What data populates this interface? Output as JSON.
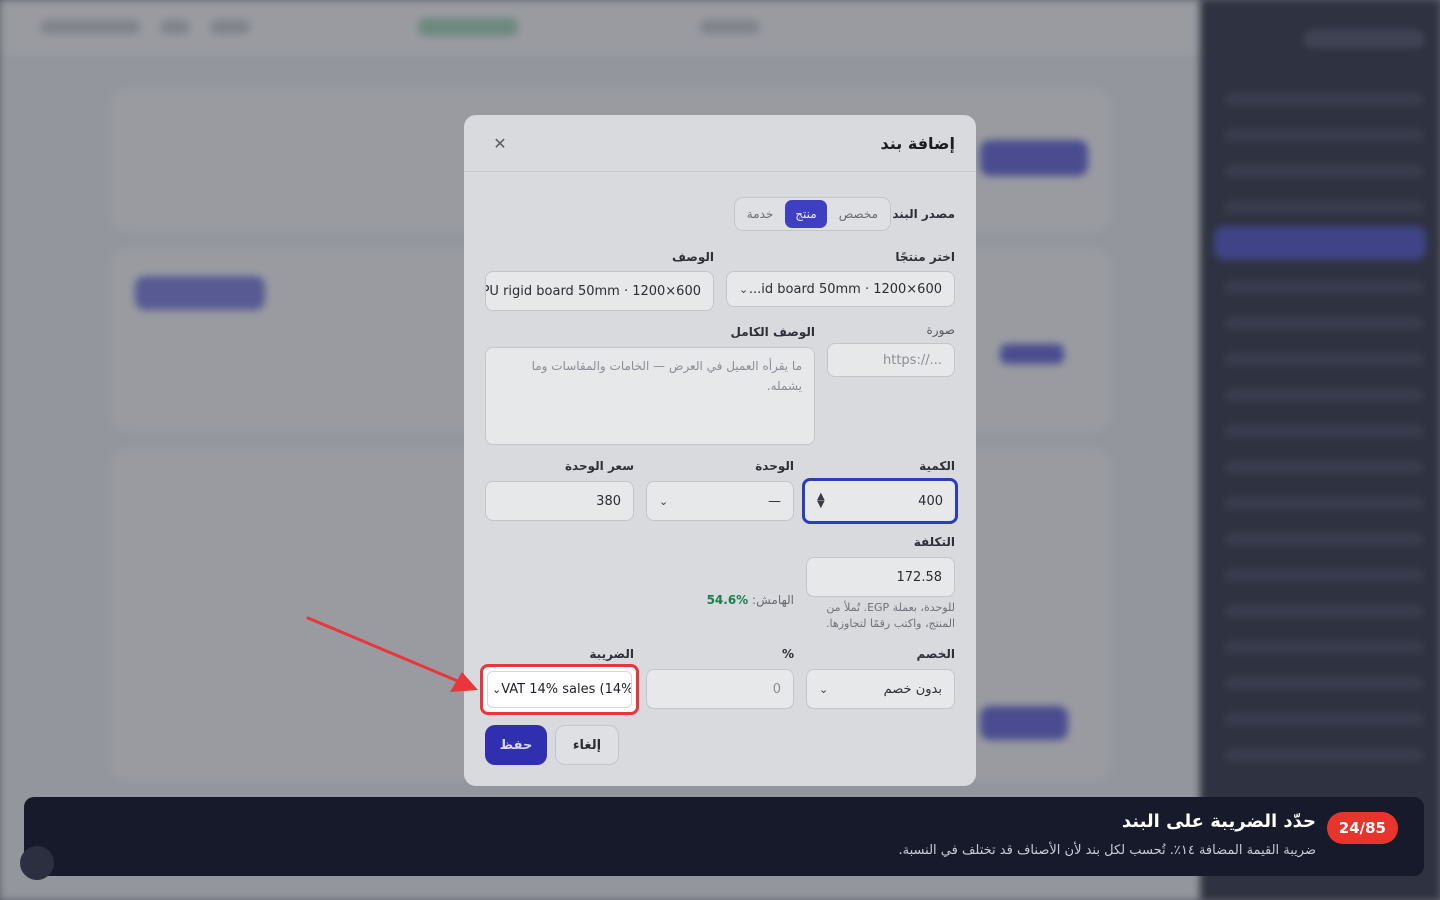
{
  "modal": {
    "title": "إضافة بند",
    "source": {
      "label": "مصدر البند",
      "options": [
        "مخصص",
        "منتج",
        "خدمة"
      ],
      "selected": "منتج"
    },
    "product_label": "اختر منتجًا",
    "product_value": "...id board 50mm · 1200×600",
    "description_label": "الوصف",
    "description_value": "PU rigid board 50mm · 1200×600",
    "image_label": "صورة",
    "image_placeholder": "https://...",
    "full_description_label": "الوصف الكامل",
    "full_description_placeholder": "ما يقرأه العميل في العرض — الخامات والمقاسات وما يشمله.",
    "quantity_label": "الكمية",
    "quantity_value": "400",
    "unit_label": "الوحدة",
    "unit_value": "—",
    "unit_price_label": "سعر الوحدة",
    "unit_price_value": "380",
    "cost_label": "التكلفة",
    "cost_value": "172.58",
    "cost_hint_line1": "للوحدة، بعملة EGP. تُملأ من",
    "cost_hint_line2": "المنتج، واكتب رقمًا لتجاوزها.",
    "margin_label": "الهامش:",
    "margin_value": "54.6%",
    "discount_label": "الخصم",
    "discount_value": "بدون خصم",
    "percent_label": "%",
    "percent_value": "0",
    "tax_label": "الضريبة",
    "tax_value": "VAT 14% sales (14%)",
    "save_label": "حفظ",
    "cancel_label": "إلغاء"
  },
  "tour": {
    "counter": "24/85",
    "title": "حدّد الضريبة على البند",
    "description": "ضريبة القيمة المضافة ١٤٪. تُحسب لكل بند لأن الأصناف قد تختلف في النسبة."
  },
  "icons": {
    "close": "close-icon",
    "chevron": "chevron-down-icon",
    "stepper": "stepper-icon",
    "arrow": "annotation-arrow"
  },
  "colors": {
    "accent": "#3f3fc3",
    "highlight": "#e8363b",
    "tour_background": "#161a2b",
    "margin_positive": "#17804e"
  }
}
